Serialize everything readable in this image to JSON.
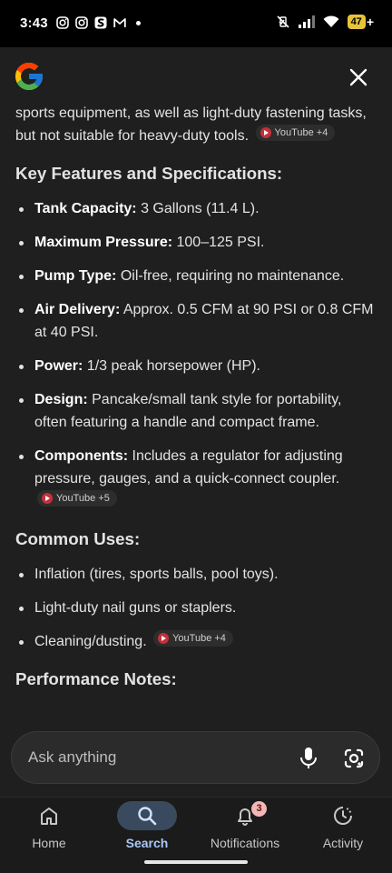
{
  "status_bar": {
    "time": "3:43",
    "battery": "47",
    "battery_plus": "+"
  },
  "header": {
    "logo": "google-logo",
    "close_icon": "close-icon"
  },
  "content": {
    "intro_text": "sports equipment, as well as light-duty fastening tasks, but not suitable for heavy-duty tools.",
    "intro_source": "YouTube +4",
    "key_features_title": "Key Features and Specifications:",
    "features": [
      {
        "label": "Tank Capacity:",
        "text": " 3 Gallons (11.4 L)."
      },
      {
        "label": "Maximum Pressure:",
        "text": " 100–125 PSI."
      },
      {
        "label": "Pump Type:",
        "text": " Oil-free, requiring no maintenance."
      },
      {
        "label": "Air Delivery:",
        "text": " Approx. 0.5 CFM at 90 PSI or 0.8 CFM at 40 PSI."
      },
      {
        "label": "Power:",
        "text": " 1/3 peak horsepower (HP)."
      },
      {
        "label": "Design:",
        "text": " Pancake/small tank style for portability, often featuring a handle and compact frame."
      },
      {
        "label": "Components:",
        "text": " Includes a regulator for adjusting pressure, gauges, and a quick-connect coupler.",
        "source": "YouTube +5"
      }
    ],
    "common_uses_title": "Common Uses:",
    "uses": [
      {
        "text": "Inflation (tires, sports balls, pool toys)."
      },
      {
        "text": "Light-duty nail guns or staplers."
      },
      {
        "text": "Cleaning/dusting.",
        "source": "YouTube +4"
      }
    ],
    "performance_title": "Performance Notes:"
  },
  "ask_bar": {
    "placeholder": "Ask anything"
  },
  "bottom_nav": {
    "items": [
      {
        "label": "Home",
        "icon": "home-icon"
      },
      {
        "label": "Search",
        "icon": "search-icon",
        "active": true
      },
      {
        "label": "Notifications",
        "icon": "bell-icon",
        "badge": "3"
      },
      {
        "label": "Activity",
        "icon": "activity-icon"
      }
    ]
  },
  "colors": {
    "background": "#1f1f1f",
    "active_pill": "#3a4a5e",
    "active_label": "#a8c7fa",
    "badge": "#f2b8b5",
    "battery": "#e8c33a"
  }
}
